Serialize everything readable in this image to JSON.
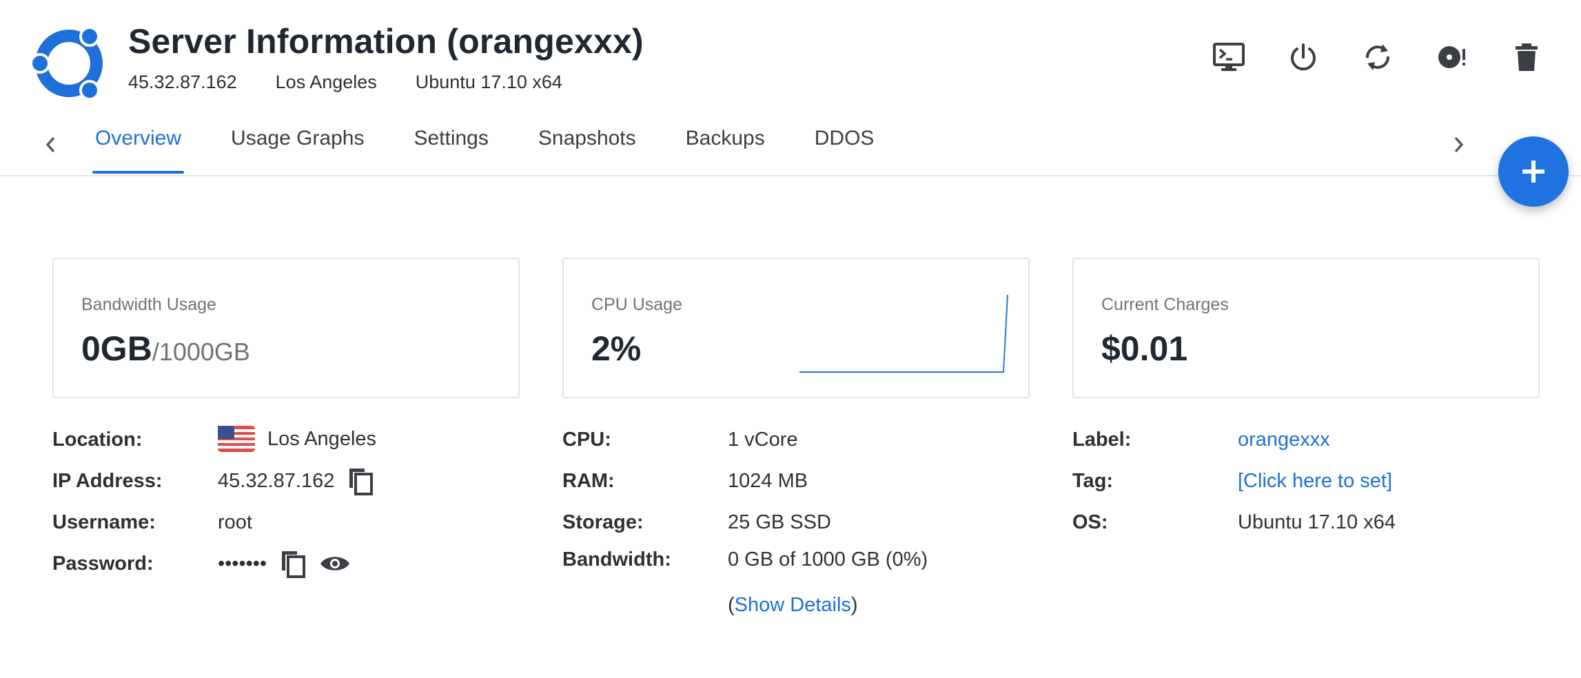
{
  "header": {
    "title": "Server Information (orangexxx)",
    "ip": "45.32.87.162",
    "location": "Los Angeles",
    "os": "Ubuntu 17.10 x64",
    "actions": [
      "console-icon",
      "power-icon",
      "restart-icon",
      "reinstall-icon",
      "delete-icon"
    ]
  },
  "tabs": [
    {
      "label": "Overview",
      "active": true
    },
    {
      "label": "Usage Graphs"
    },
    {
      "label": "Settings"
    },
    {
      "label": "Snapshots"
    },
    {
      "label": "Backups"
    },
    {
      "label": "DDOS"
    }
  ],
  "cards": {
    "bandwidth": {
      "label": "Bandwidth Usage",
      "value": "0GB",
      "suffix": "/1000GB"
    },
    "cpu": {
      "label": "CPU Usage",
      "value": "2%"
    },
    "charges": {
      "label": "Current Charges",
      "value": "$0.01"
    }
  },
  "details_left": {
    "location_key": "Location:",
    "location_val": "Los Angeles",
    "ip_key": "IP Address:",
    "ip_val": "45.32.87.162",
    "username_key": "Username:",
    "username_val": "root",
    "password_key": "Password:",
    "password_val": "•••••••"
  },
  "details_mid": {
    "cpu_key": "CPU:",
    "cpu_val": "1 vCore",
    "ram_key": "RAM:",
    "ram_val": "1024 MB",
    "storage_key": "Storage:",
    "storage_val": "25 GB SSD",
    "bandwidth_key": "Bandwidth:",
    "bandwidth_val": "0 GB of 1000 GB (0%)",
    "show_details_open": "(",
    "show_details": "Show Details",
    "show_details_close": ")"
  },
  "details_right": {
    "label_key": "Label:",
    "label_val": "orangexxx",
    "tag_key": "Tag:",
    "tag_val": "[Click here to set]",
    "os_key": "OS:",
    "os_val": "Ubuntu 17.10 x64"
  },
  "colors": {
    "accent": "#1e6fd9",
    "fab": "#1e73e0",
    "text": "#2c3136",
    "muted": "#6c737b"
  }
}
